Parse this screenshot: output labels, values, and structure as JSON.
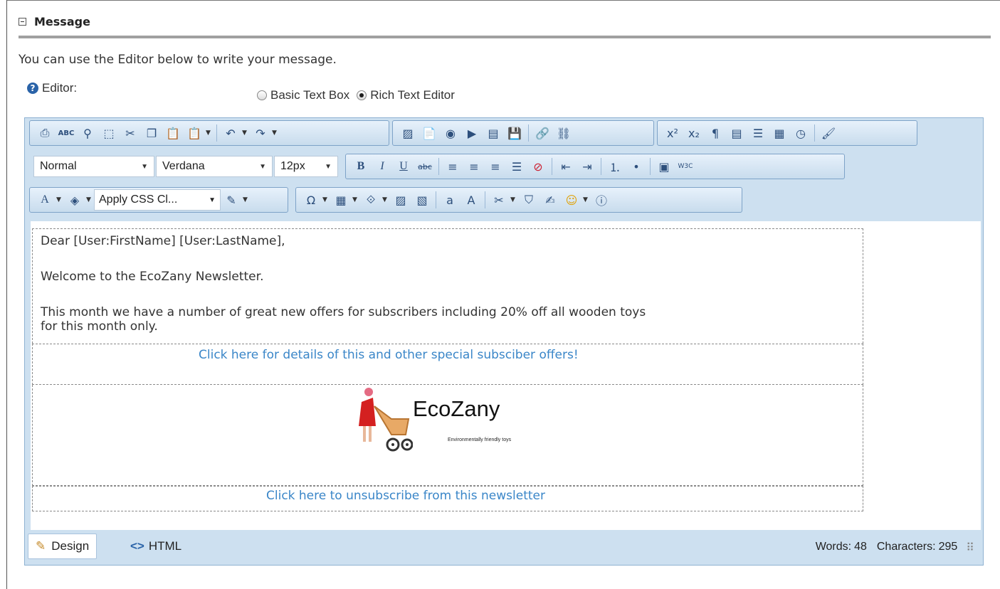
{
  "section": {
    "title": "Message",
    "collapse_icon": "collapse-minus-icon"
  },
  "intro_text": "You can use the Editor below to write your message.",
  "editor_field": {
    "label": "Editor:",
    "help_icon": "help-question-icon"
  },
  "editor_mode": {
    "options": [
      {
        "label": "Basic Text Box",
        "checked": false
      },
      {
        "label": "Rich Text Editor",
        "checked": true
      }
    ]
  },
  "toolbar": {
    "paragraph_style": "Normal",
    "font_name": "Verdana",
    "font_size": "12px",
    "css_class": "Apply CSS Cl...",
    "icons_row1": [
      "print",
      "spellcheck",
      "find",
      "select-all",
      "cut",
      "copy",
      "paste",
      "paste-options",
      "undo",
      "redo",
      "image-manager",
      "document-manager",
      "flash-manager",
      "media-manager",
      "template-manager",
      "save-template",
      "hyperlink",
      "remove-link",
      "superscript",
      "subscript",
      "paragraph-marks",
      "format-code",
      "align-justify",
      "page-properties",
      "insert-date",
      "format-stripper"
    ],
    "icons_row2": [
      "bold",
      "italic",
      "underline",
      "strikethrough",
      "align-left",
      "align-center",
      "align-right",
      "justify",
      "remove-format",
      "outdent",
      "indent",
      "numbered-list",
      "bulleted-list",
      "toggle-borders",
      "xhtml-validator"
    ],
    "icons_row3": [
      "fore-color",
      "back-color",
      "css-class",
      "format-painter",
      "special-characters",
      "insert-table",
      "insert-snippet",
      "image-map",
      "absolute-position",
      "convert-lower",
      "convert-upper",
      "module-manager",
      "insert-custom",
      "form-elements",
      "emoticons",
      "about-dialog"
    ]
  },
  "content": {
    "greeting": "Dear [User:FirstName] [User:LastName],",
    "welcome": "Welcome to the EcoZany Newsletter.",
    "offer_line1": "This month we have a number of great new offers for subscribers including 20% off all wooden toys",
    "offer_line2": "for this month only.",
    "offers_link": "Click here for details of this and other special subsciber offers!",
    "logo_name": "EcoZany",
    "logo_tagline": "Environmentally friendly toys",
    "unsubscribe_link": "Click here to unsubscribe from this newsletter"
  },
  "footer": {
    "design_tab": "Design",
    "html_tab": "HTML",
    "words_label": "Words:",
    "words_count": "48",
    "chars_label": "Characters:",
    "chars_count": "295"
  },
  "colors": {
    "toolbar_bg": "#cde0f0",
    "link": "#3a86c8",
    "accent": "#2a63a8"
  }
}
